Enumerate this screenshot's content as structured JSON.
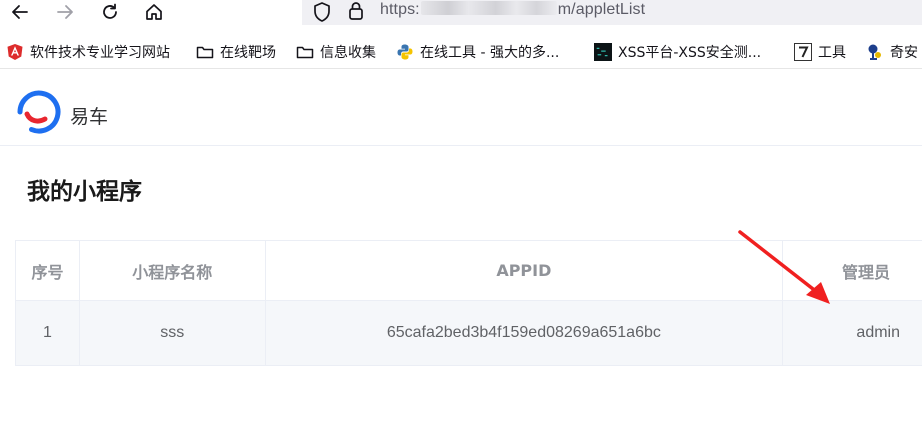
{
  "browser": {
    "url_scheme": "https:",
    "url_suffix": "m/appletList"
  },
  "bookmarks": [
    {
      "label": "软件技术专业学习网站",
      "icon": "angular-icon"
    },
    {
      "label": "在线靶场",
      "icon": "folder-icon"
    },
    {
      "label": "信息收集",
      "icon": "folder-icon"
    },
    {
      "label": "在线工具 - 强大的多...",
      "icon": "python-icon"
    },
    {
      "label": "XSS平台-XSS安全测...",
      "icon": "terminal-icon"
    },
    {
      "label": "工具",
      "icon": "seven-icon"
    },
    {
      "label": "奇安",
      "icon": "qianxin-icon"
    }
  ],
  "app": {
    "brand": "易车",
    "page_title": "我的小程序"
  },
  "table": {
    "headers": [
      "序号",
      "小程序名称",
      "APPID",
      "管理员"
    ],
    "rows": [
      [
        "1",
        "sss",
        "65cafa2bed3b4f159ed08269a651a6bc",
        "admin"
      ]
    ]
  },
  "colors": {
    "logo_blue": "#1e6ff0",
    "logo_red": "#e8262f",
    "arrow_red": "#f02020",
    "header_text": "#909399",
    "cell_text": "#606266"
  }
}
